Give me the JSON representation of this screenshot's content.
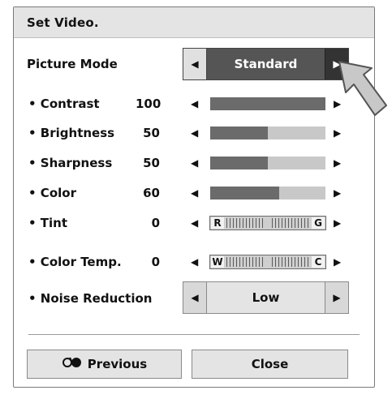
{
  "dialog": {
    "title": "Set Video."
  },
  "picture_mode": {
    "label": "Picture Mode",
    "value": "Standard"
  },
  "sliders": [
    {
      "label": "• Contrast",
      "value": "100",
      "level": 1.0
    },
    {
      "label": "• Brightness",
      "value": "50",
      "level": 0.5
    },
    {
      "label": "• Sharpness",
      "value": "50",
      "level": 0.5
    },
    {
      "label": "• Color",
      "value": "60",
      "level": 0.6
    }
  ],
  "tint": {
    "label": "• Tint",
    "value": "0",
    "left_end": "R",
    "right_end": "G"
  },
  "color_temp": {
    "label": "• Color Temp.",
    "value": "0",
    "left_end": "W",
    "right_end": "C"
  },
  "noise_reduction": {
    "label": "• Noise Reduction",
    "value": "Low"
  },
  "buttons": {
    "previous": "Previous",
    "close": "Close"
  },
  "icons": {
    "left_arrow": "◀",
    "right_arrow": "▶",
    "previous_icon": "back-icon",
    "cursor": "pointer-cursor"
  },
  "colors": {
    "titlebar": "#e4e4e4",
    "selected_button": "#555555",
    "bar_fill": "#6b6b6b",
    "bar_track": "#c8c8c8"
  }
}
